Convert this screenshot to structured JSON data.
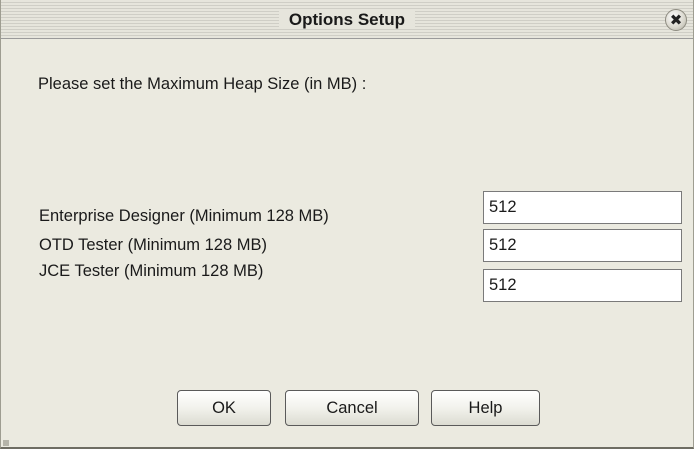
{
  "window": {
    "title": "Options Setup"
  },
  "icons": {
    "close": "close-icon"
  },
  "prompt": "Please set the Maximum Heap Size (in MB) :",
  "fields": [
    {
      "label": "Enterprise Designer (Minimum 128 MB)",
      "value": "512"
    },
    {
      "label": "OTD Tester (Minimum 128 MB)",
      "value": "512"
    },
    {
      "label": "JCE Tester (Minimum 128 MB)",
      "value": "512"
    }
  ],
  "buttons": {
    "ok": "OK",
    "cancel": "Cancel",
    "help": "Help"
  }
}
